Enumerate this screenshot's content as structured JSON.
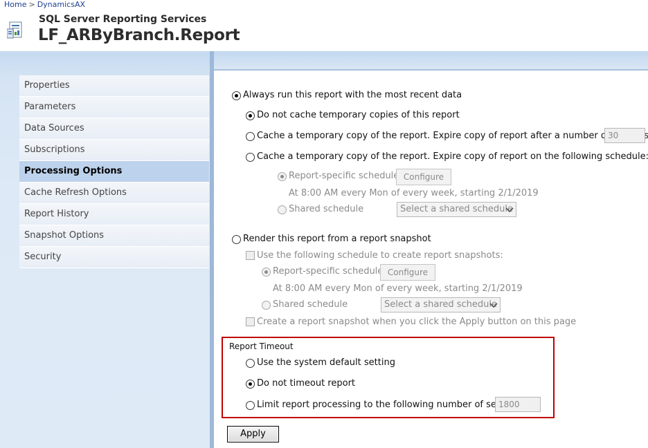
{
  "breadcrumb": {
    "home": "Home",
    "separator": ">",
    "current": "DynamicsAX"
  },
  "header": {
    "app_name": "SQL Server Reporting Services",
    "report_title": "LF_ARByBranch.Report",
    "icon": "report-document-icon"
  },
  "sidebar": {
    "items": [
      {
        "label": "Properties",
        "active": false
      },
      {
        "label": "Parameters",
        "active": false
      },
      {
        "label": "Data Sources",
        "active": false
      },
      {
        "label": "Subscriptions",
        "active": false
      },
      {
        "label": "Processing Options",
        "active": true
      },
      {
        "label": "Cache Refresh Options",
        "active": false
      },
      {
        "label": "Report History",
        "active": false
      },
      {
        "label": "Snapshot Options",
        "active": false
      },
      {
        "label": "Security",
        "active": false
      }
    ]
  },
  "processing": {
    "always_run": {
      "label": "Always run this report with the most recent data",
      "checked": true
    },
    "no_cache": {
      "label": "Do not cache temporary copies of this report",
      "checked": true
    },
    "cache_minutes": {
      "label": "Cache a temporary copy of the report. Expire copy of report after a number of minutes:",
      "value": "30",
      "checked": false
    },
    "cache_schedule": {
      "label": "Cache a temporary copy of the report. Expire copy of report on the following schedule:",
      "checked": false
    },
    "cache_report_specific": {
      "label": "Report-specific schedule",
      "configure": "Configure",
      "description": "At 8:00 AM every Mon of every week, starting 2/1/2019"
    },
    "cache_shared": {
      "label": "Shared schedule",
      "select": "Select a shared schedule"
    },
    "render_snapshot": {
      "label": "Render this report from a report snapshot",
      "checked": false
    },
    "snapshot_use_schedule": {
      "label": "Use the following schedule to create report snapshots:"
    },
    "snapshot_report_specific": {
      "label": "Report-specific schedule",
      "configure": "Configure",
      "description": "At 8:00 AM every Mon of every week, starting 2/1/2019"
    },
    "snapshot_shared": {
      "label": "Shared schedule",
      "select": "Select a shared schedule"
    },
    "snapshot_apply": {
      "label": "Create a report snapshot when you click the Apply button on this page"
    }
  },
  "timeout": {
    "title": "Report Timeout",
    "system_default": {
      "label": "Use the system default setting",
      "checked": false
    },
    "no_timeout": {
      "label": "Do not timeout report",
      "checked": true
    },
    "limit": {
      "label": "Limit report processing to the following number of seconds:",
      "value": "1800",
      "checked": false
    }
  },
  "actions": {
    "apply": "Apply"
  },
  "colors": {
    "accent": "#c00000",
    "sidebar": "#dde9f6",
    "active_nav": "#bdd2ec",
    "link": "#1f3f8f"
  }
}
